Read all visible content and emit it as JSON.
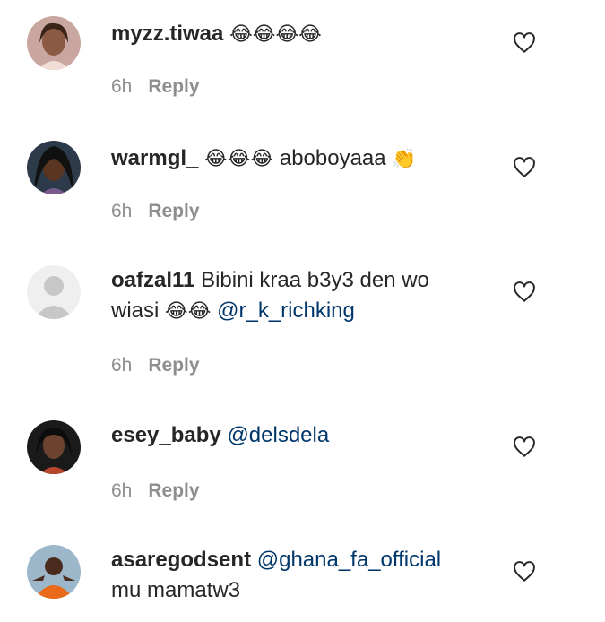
{
  "comments": [
    {
      "username": "myzz.tiwaa",
      "text": "",
      "emoji": "😂😂😂😂",
      "time": "6h",
      "reply": "Reply",
      "avatar_icon": "user-avatar-photo"
    },
    {
      "username": "warmgl_",
      "text": "aboboyaaa",
      "emoji": "😂😂😂",
      "emoji_after": "👏",
      "time": "6h",
      "reply": "Reply",
      "avatar_icon": "user-avatar-photo"
    },
    {
      "username": "oafzal11",
      "text": "Bibini kraa b3y3 den wo",
      "text2": "wiasi",
      "emoji": "😂😂",
      "mention": "@r_k_richking",
      "time": "6h",
      "reply": "Reply",
      "avatar_icon": "default-avatar"
    },
    {
      "username": "esey_baby",
      "mention": "@delsdela",
      "time": "6h",
      "reply": "Reply",
      "avatar_icon": "user-avatar-photo"
    },
    {
      "username": "asaregodsent",
      "mention": "@ghana_fa_official",
      "text2": "mu mamatw3",
      "avatar_icon": "user-avatar-photo"
    }
  ],
  "colors": {
    "mention": "#00376b",
    "meta": "#8e8e8e",
    "text": "#262626"
  }
}
